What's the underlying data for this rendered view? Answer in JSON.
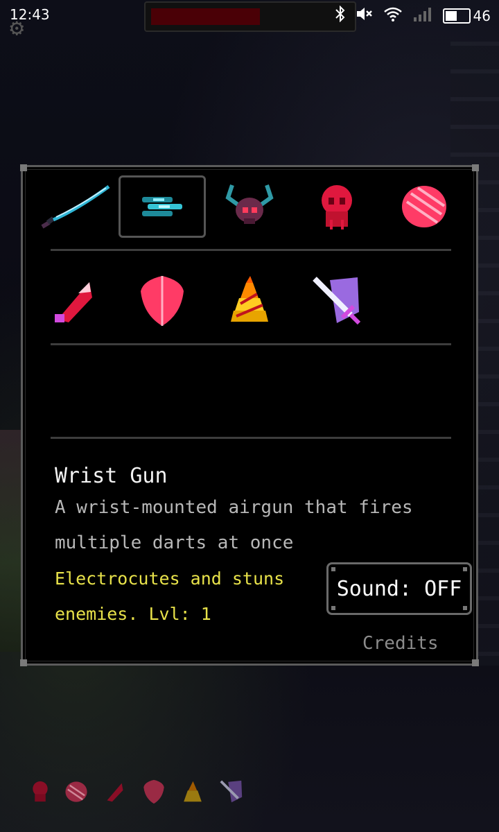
{
  "status_bar": {
    "time": "12:43",
    "battery_level": "46",
    "icons": [
      "bluetooth-icon",
      "mute-icon",
      "wifi-icon",
      "signal-icon",
      "battery-icon"
    ]
  },
  "hud": {
    "settings_icon": "gear-icon",
    "health_fraction": 0.55
  },
  "items_row1": [
    {
      "name": "sword-item",
      "selected": false
    },
    {
      "name": "wrist-gun-item",
      "selected": true
    },
    {
      "name": "horned-skull-item",
      "selected": false
    },
    {
      "name": "red-skull-item",
      "selected": false
    },
    {
      "name": "pink-orb-item",
      "selected": false
    }
  ],
  "items_row2": [
    {
      "name": "dagger-item"
    },
    {
      "name": "shield-item"
    },
    {
      "name": "fire-trap-item"
    },
    {
      "name": "sword-shield-item"
    }
  ],
  "detail": {
    "title": "Wrist Gun",
    "description": "A wrist-mounted airgun that fires multiple darts at once",
    "effect": "Electrocutes and stuns enemies. Lvl: 1"
  },
  "sound_button": "Sound: OFF",
  "credits_link": "Credits",
  "colors": {
    "panel_border": "#5b5b5b",
    "effect_text": "#e8e24a",
    "accent_red": "#ff3b5c"
  }
}
